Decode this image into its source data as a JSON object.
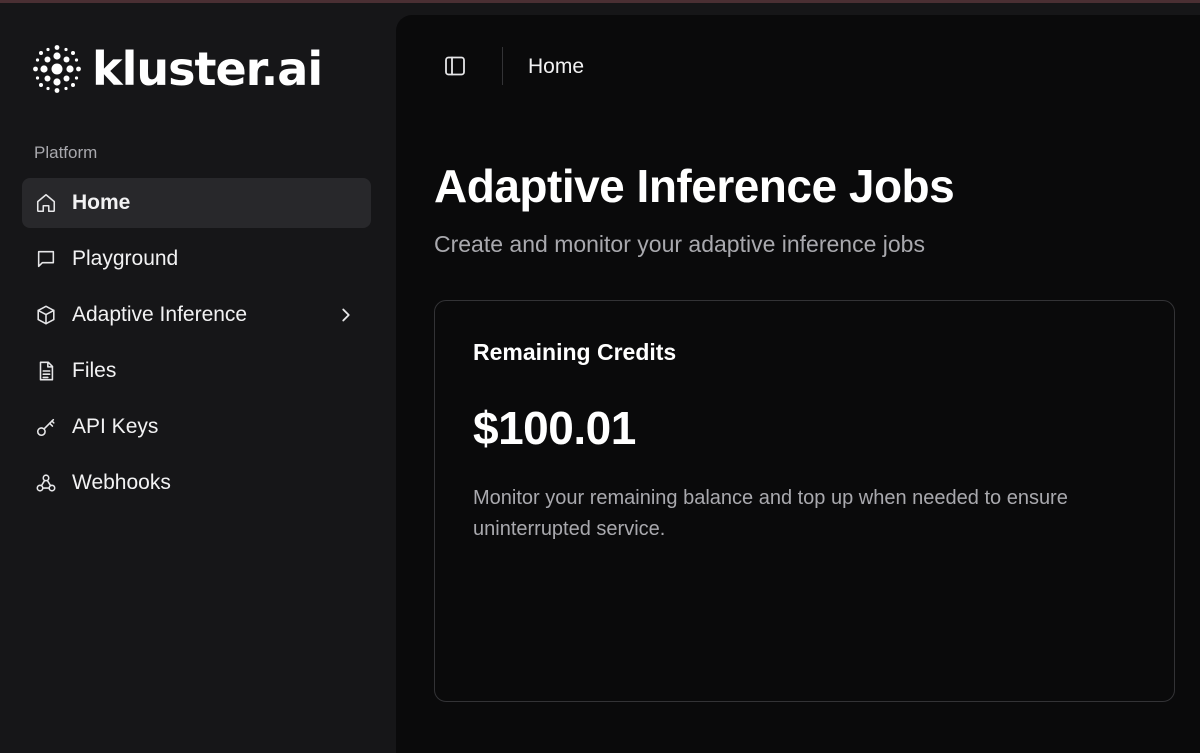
{
  "brand": {
    "name": "kluster.ai"
  },
  "sidebar": {
    "section_label": "Platform",
    "items": [
      {
        "label": "Home",
        "icon": "home-icon",
        "active": true
      },
      {
        "label": "Playground",
        "icon": "chat-icon"
      },
      {
        "label": "Adaptive Inference",
        "icon": "cube-icon",
        "has_submenu": true
      },
      {
        "label": "Files",
        "icon": "file-icon"
      },
      {
        "label": "API Keys",
        "icon": "key-icon"
      },
      {
        "label": "Webhooks",
        "icon": "webhook-icon"
      }
    ]
  },
  "topbar": {
    "toggle_icon": "sidebar-toggle-icon",
    "breadcrumb": "Home"
  },
  "main": {
    "title": "Adaptive Inference Jobs",
    "subtitle": "Create and monitor your adaptive inference jobs"
  },
  "credits_card": {
    "title": "Remaining Credits",
    "value": "$100.01",
    "description": "Monitor your remaining balance and top up when needed to ensure uninterrupted service."
  },
  "colors": {
    "sidebar_bg": "#161618",
    "main_bg": "#0a0a0b",
    "active_item_bg": "#28282b",
    "muted_text": "#a9a9ae",
    "border": "#333336"
  }
}
